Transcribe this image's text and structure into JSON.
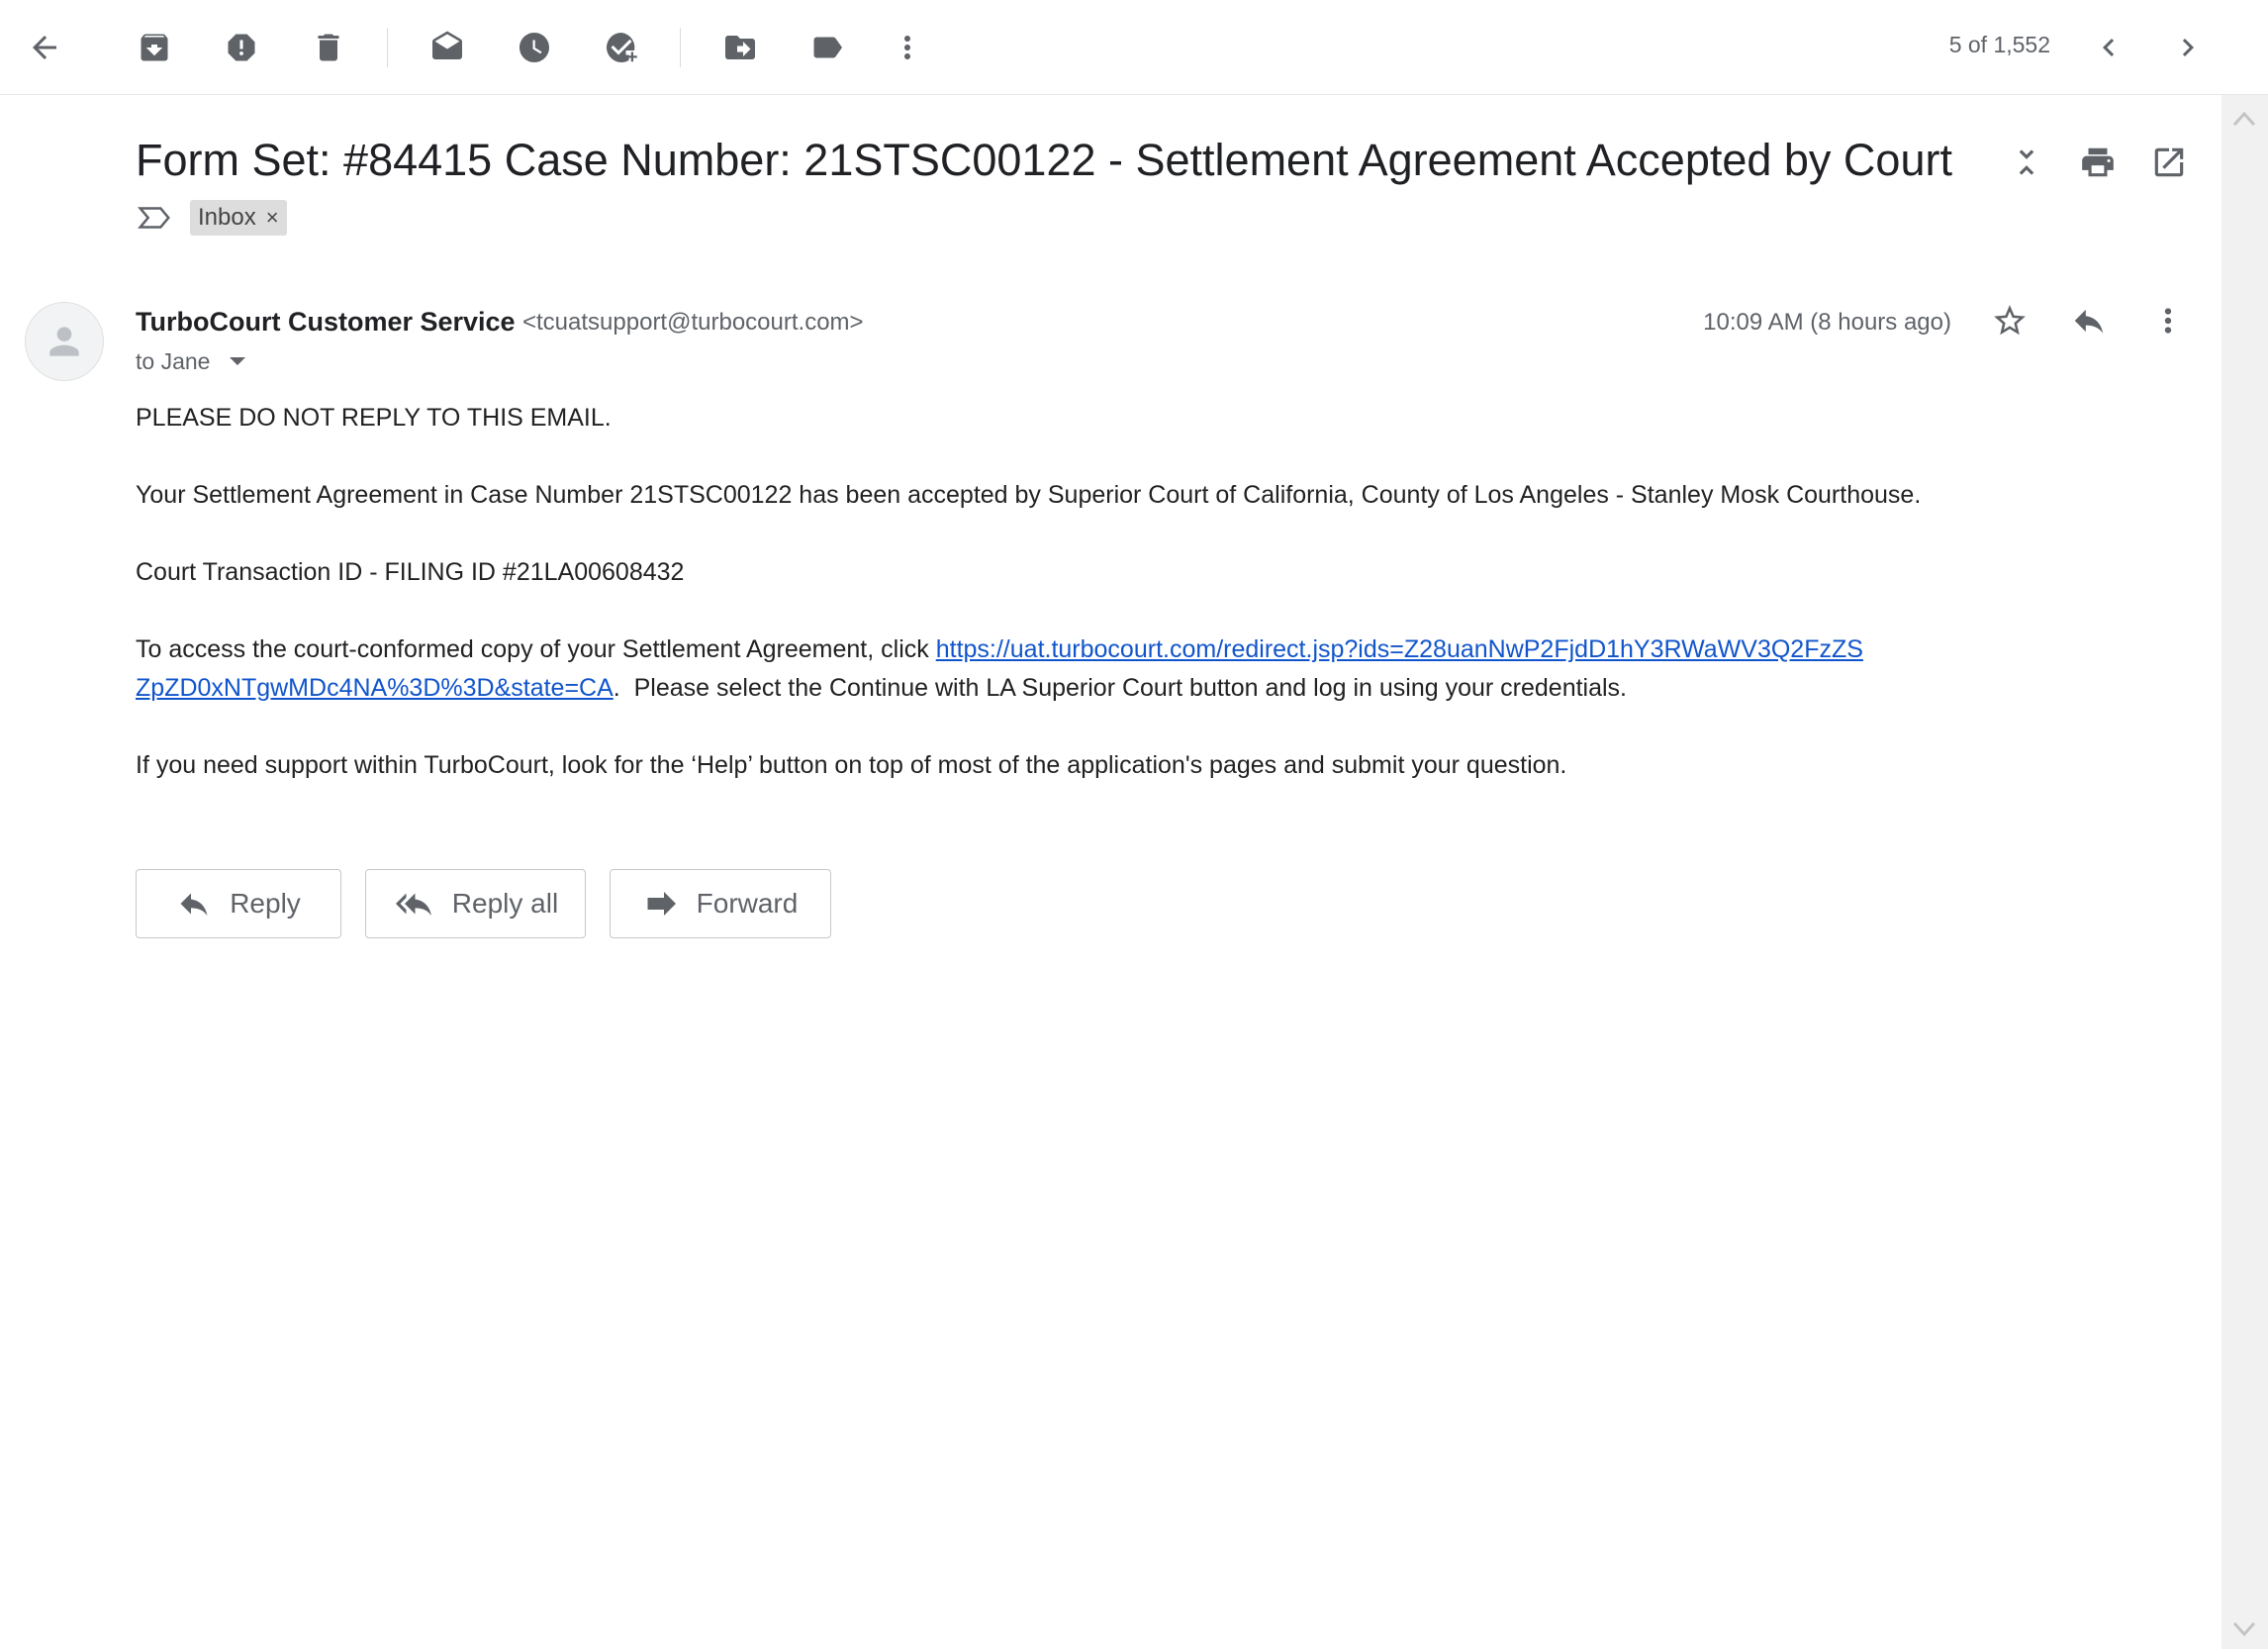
{
  "toolbar": {
    "icons": [
      "back-arrow-icon",
      "archive-icon",
      "report-spam-icon",
      "delete-icon",
      "mark-unread-icon",
      "snooze-icon",
      "add-to-tasks-icon",
      "move-to-icon",
      "labels-icon",
      "more-vert-icon"
    ],
    "counter": "5 of 1,552",
    "nav": [
      "chevron-left-icon",
      "chevron-right-icon"
    ]
  },
  "email": {
    "subject": "Form Set: #84415 Case Number: 21STSC00122 - Settlement Agreement Accepted by Court",
    "label": "Inbox",
    "label_remove": "×",
    "sender_name": "TurboCourt Customer Service",
    "sender_email": "<tcuatsupport@turbocourt.com>",
    "to": "to Jane",
    "timestamp": "10:09 AM (8 hours ago)",
    "body": {
      "line1": "PLEASE DO NOT REPLY TO THIS EMAIL.",
      "line2": "Your Settlement Agreement in Case Number 21STSC00122 has been accepted by Superior Court of California, County of Los Angeles - Stanley Mosk Courthouse.",
      "line3": "Court Transaction ID - FILING ID #21LA00608432",
      "line4_prefix": "To access the court-conformed copy of your Settlement Agreement, click ",
      "link_part1": "https://uat.turbocourt.com/redirect.jsp?ids=Z28uanNwP2FjdD1hY3RWaWV3Q2FzZS",
      "link_part2": "ZpZD0xNTgwMDc4NA%3D%3D&state=CA",
      "line5_suffix": ".  Please select the Continue with LA Superior Court button and log in using your credentials.",
      "line6": "If you need support within TurboCourt, look for the ‘Help’ button on top of most of the application's pages and submit your question."
    }
  },
  "actions": {
    "reply": "Reply",
    "reply_all": "Reply all",
    "forward": "Forward"
  }
}
